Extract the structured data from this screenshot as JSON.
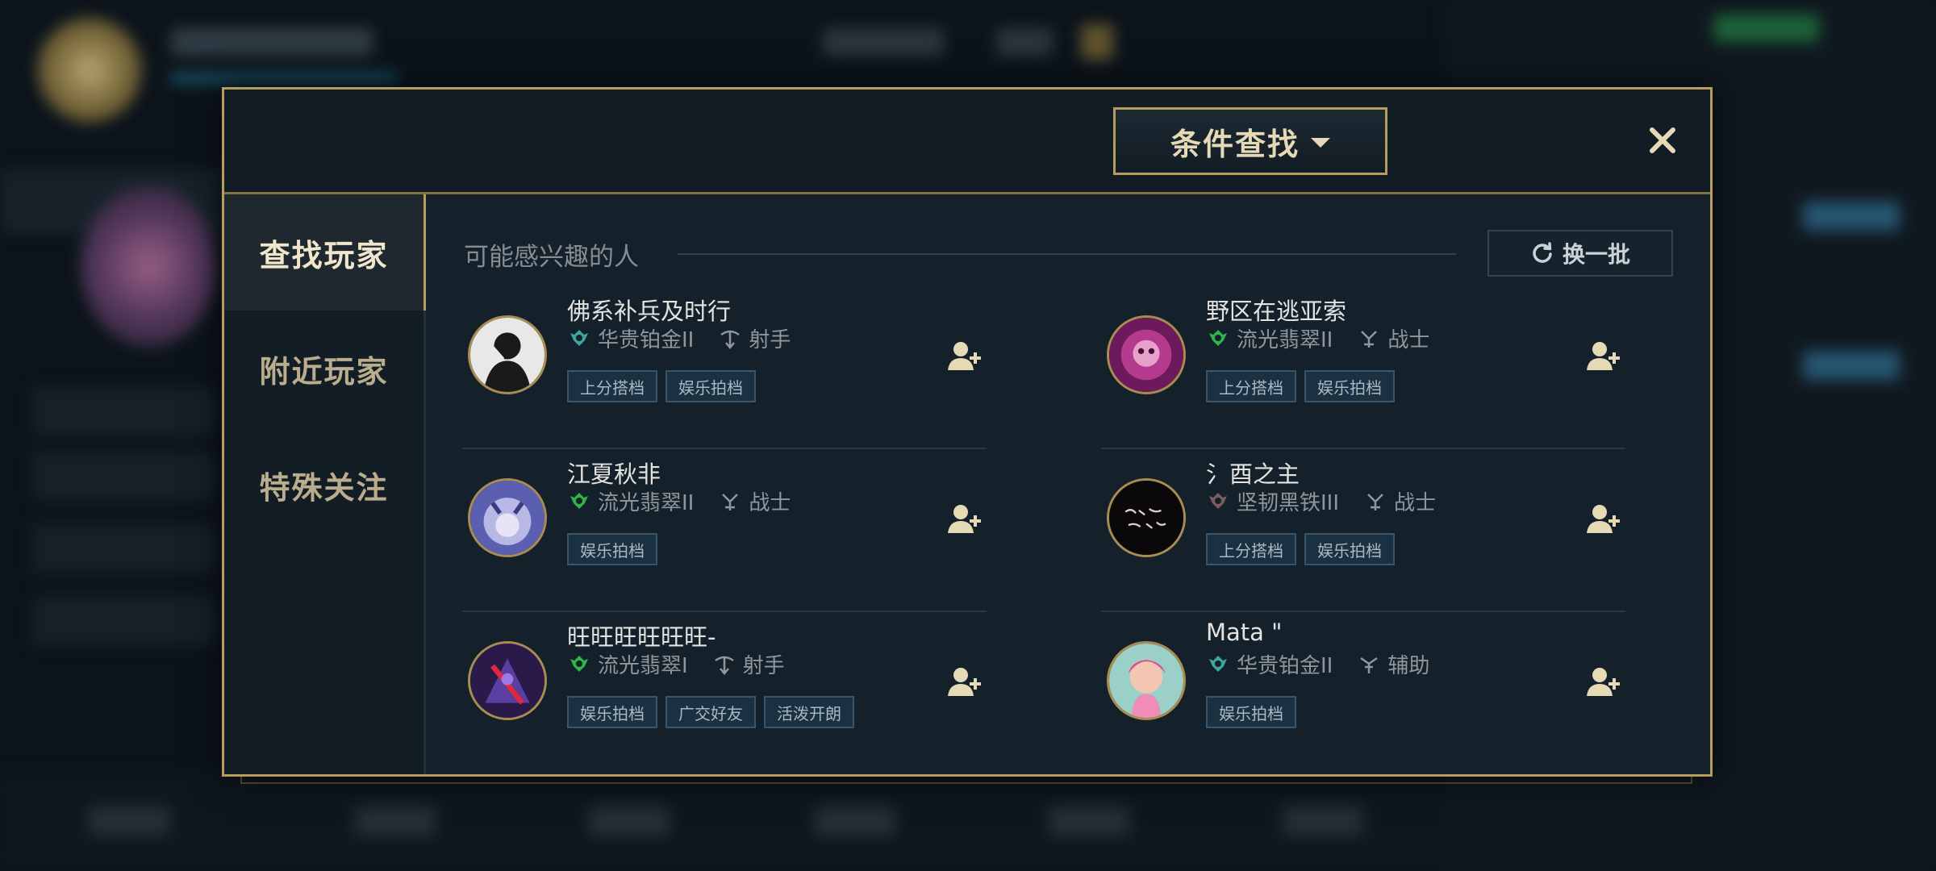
{
  "dialog": {
    "filter_button": "条件查找",
    "close_icon": "close-icon"
  },
  "sidebar": {
    "items": [
      {
        "label": "查找玩家",
        "active": true
      },
      {
        "label": "附近玩家",
        "active": false
      },
      {
        "label": "特殊关注",
        "active": false
      }
    ]
  },
  "content": {
    "section_title": "可能感兴趣的人",
    "refresh_label": "换一批",
    "players": [
      {
        "name": "佛系补兵及时行",
        "rank": "华贵铂金II",
        "rank_icon": "platinum-rank-icon",
        "role": "射手",
        "role_icon": "marksman-role-icon",
        "tags": [
          "上分搭档",
          "娱乐拍档"
        ]
      },
      {
        "name": "野区在逃亚索",
        "rank": "流光翡翠II",
        "rank_icon": "emerald-rank-icon",
        "role": "战士",
        "role_icon": "fighter-role-icon",
        "tags": [
          "上分搭档",
          "娱乐拍档"
        ]
      },
      {
        "name": "江夏秋非",
        "rank": "流光翡翠II",
        "rank_icon": "emerald-rank-icon",
        "role": "战士",
        "role_icon": "fighter-role-icon",
        "tags": [
          "娱乐拍档"
        ]
      },
      {
        "name": "氵酉之主",
        "rank": "坚韧黑铁III",
        "rank_icon": "iron-rank-icon",
        "role": "战士",
        "role_icon": "fighter-role-icon",
        "tags": [
          "上分搭档",
          "娱乐拍档"
        ]
      },
      {
        "name": "旺旺旺旺旺旺-",
        "rank": "流光翡翠I",
        "rank_icon": "emerald-rank-icon",
        "role": "射手",
        "role_icon": "marksman-role-icon",
        "tags": [
          "娱乐拍档",
          "广交好友",
          "活泼开朗"
        ]
      },
      {
        "name": "Mata \"",
        "rank": "华贵铂金II",
        "rank_icon": "platinum-rank-icon",
        "role": "辅助",
        "role_icon": "support-role-icon",
        "tags": [
          "娱乐拍档"
        ]
      }
    ]
  },
  "colors": {
    "gold_border": "#b79c5f",
    "dialog_bg": "#14202a",
    "emerald": "#2fb34a",
    "platinum": "#3aa6a0",
    "iron": "#7a5d63",
    "tag_bg": "#1b3040"
  }
}
